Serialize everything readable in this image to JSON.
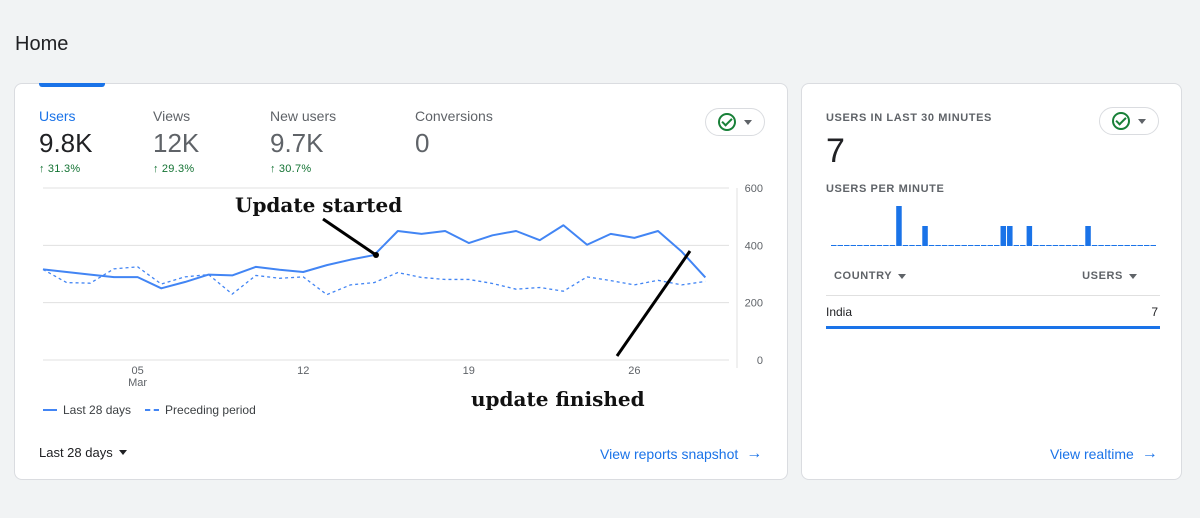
{
  "page": {
    "title": "Home"
  },
  "metrics": [
    {
      "label": "Users",
      "value": "9.8K",
      "change": "31.3%"
    },
    {
      "label": "Views",
      "value": "12K",
      "change": "29.3%"
    },
    {
      "label": "New users",
      "value": "9.7K",
      "change": "30.7%"
    },
    {
      "label": "Conversions",
      "value": "0",
      "change": ""
    }
  ],
  "chart_data": {
    "type": "line",
    "x": [
      1,
      2,
      3,
      4,
      5,
      6,
      7,
      8,
      9,
      10,
      11,
      12,
      13,
      14,
      15,
      16,
      17,
      18,
      19,
      20,
      21,
      22,
      23,
      24,
      25,
      26,
      27,
      28,
      29,
      30
    ],
    "x_ticks": [
      {
        "x": 5,
        "label": "05",
        "sub": "Mar"
      },
      {
        "x": 12,
        "label": "12",
        "sub": ""
      },
      {
        "x": 19,
        "label": "19",
        "sub": ""
      },
      {
        "x": 26,
        "label": "26",
        "sub": ""
      }
    ],
    "y_ticks": [
      "600",
      "400",
      "200",
      "0"
    ],
    "ylim": [
      0,
      600
    ],
    "series": [
      {
        "name": "Last 28 days",
        "style": "solid",
        "color": "#4285f4",
        "values": [
          316,
          307,
          298,
          289,
          289,
          250,
          272,
          298,
          295,
          325,
          315,
          307,
          331,
          350,
          366,
          450,
          440,
          450,
          408,
          435,
          450,
          418,
          470,
          402,
          440,
          426,
          450,
          378,
          288
        ]
      },
      {
        "name": "Preceding period",
        "style": "dashed",
        "color": "#4285f4",
        "values": [
          316,
          270,
          268,
          318,
          325,
          265,
          290,
          298,
          230,
          295,
          285,
          290,
          228,
          262,
          270,
          305,
          288,
          281,
          281,
          267,
          247,
          253,
          240,
          290,
          277,
          262,
          278,
          262,
          274
        ]
      }
    ],
    "annotations": [
      "Update started",
      "update finished"
    ]
  },
  "legend": {
    "current": "Last 28 days",
    "previous": "Preceding period"
  },
  "footer": {
    "range": "Last 28 days",
    "link": "View reports snapshot"
  },
  "realtime": {
    "title": "USERS IN LAST 30 MINUTES",
    "value": "7",
    "subtitle": "USERS PER MINUTE",
    "per_minute": [
      0,
      0,
      0,
      0,
      0,
      0,
      0,
      0,
      0,
      0,
      4,
      0,
      0,
      0,
      2,
      0,
      0,
      0,
      0,
      0,
      0,
      0,
      0,
      0,
      0,
      0,
      2,
      2,
      0,
      0,
      2,
      0,
      0,
      0,
      0,
      0,
      0,
      0,
      0,
      2,
      0,
      0,
      0,
      0,
      0,
      0,
      0,
      0,
      0,
      0
    ],
    "col_country": "COUNTRY",
    "col_users": "USERS",
    "rows": [
      {
        "country": "India",
        "users": "7"
      }
    ],
    "link": "View realtime"
  },
  "colors": {
    "accent": "#1a73e8",
    "series": "#4285f4",
    "positive": "#137333"
  }
}
